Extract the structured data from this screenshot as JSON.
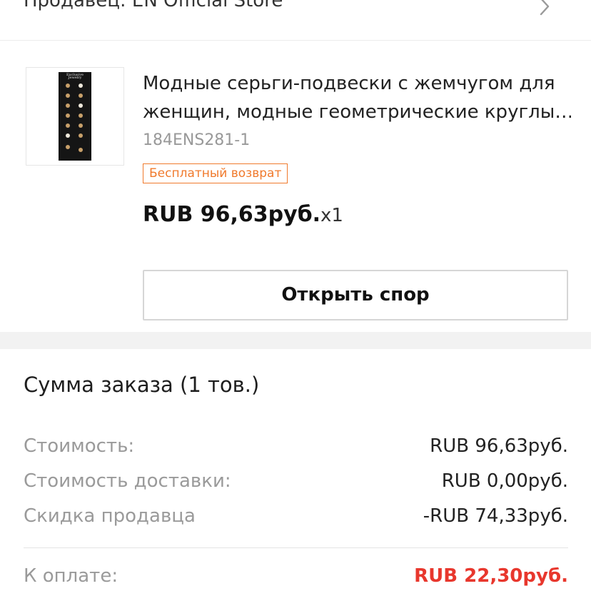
{
  "seller": {
    "label": "Продавец: EN Official Store"
  },
  "product": {
    "image_caption": "Exclusive Jewelry",
    "title_line1": "Модные серьги-подвески с жемчугом для",
    "title_line2": "женщин, модные геометрические круглы…",
    "sku": "184ENS281-1",
    "badge": "Бесплатный возврат",
    "price": "RUB 96,63руб.",
    "quantity": "x1",
    "dispute_button": "Открыть спор"
  },
  "summary": {
    "title": "Сумма заказа (1 тов.)",
    "rows": [
      {
        "label": "Стоимость:",
        "value": "RUB 96,63руб."
      },
      {
        "label": "Стоимость доставки:",
        "value": "RUB 0,00руб."
      },
      {
        "label": "Скидка продавца",
        "value": "-RUB 74,33руб."
      }
    ],
    "total": {
      "label": "К оплате:",
      "value": "RUB 22,30руб."
    }
  },
  "colors": {
    "accent_red": "#e8372d",
    "badge_orange": "#f07a2d",
    "muted_text": "#9a9a9a"
  },
  "icons": [
    "chevron-right-icon"
  ]
}
